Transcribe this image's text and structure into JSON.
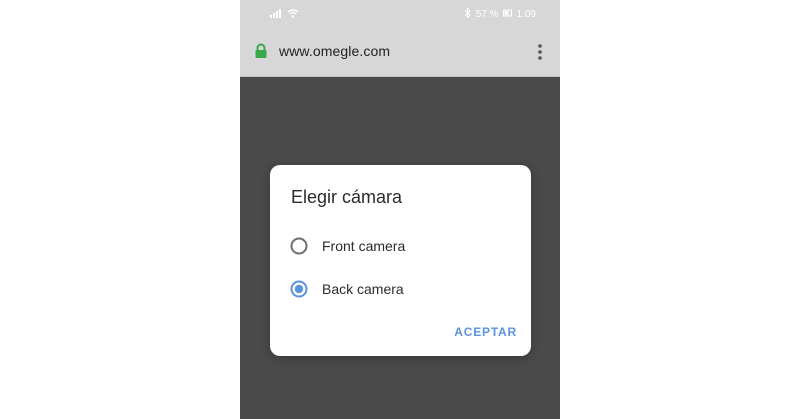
{
  "status_bar": {
    "battery": "57 %",
    "time": "1:09"
  },
  "browser": {
    "url": "www.omegle.com"
  },
  "dialog": {
    "title": "Elegir cámara",
    "options": [
      {
        "label": "Front camera",
        "selected": false
      },
      {
        "label": "Back camera",
        "selected": true
      }
    ],
    "accept_label": "ACEPTAR"
  },
  "colors": {
    "accent": "#5b93de",
    "lock_green": "#39a84a",
    "overlay": "#4a4a4a"
  },
  "icons": {
    "signal": "signal-icon",
    "wifi": "wifi-icon",
    "bluetooth": "bluetooth-icon",
    "battery": "battery-icon",
    "lock": "lock-icon",
    "menu": "overflow-menu-icon"
  }
}
